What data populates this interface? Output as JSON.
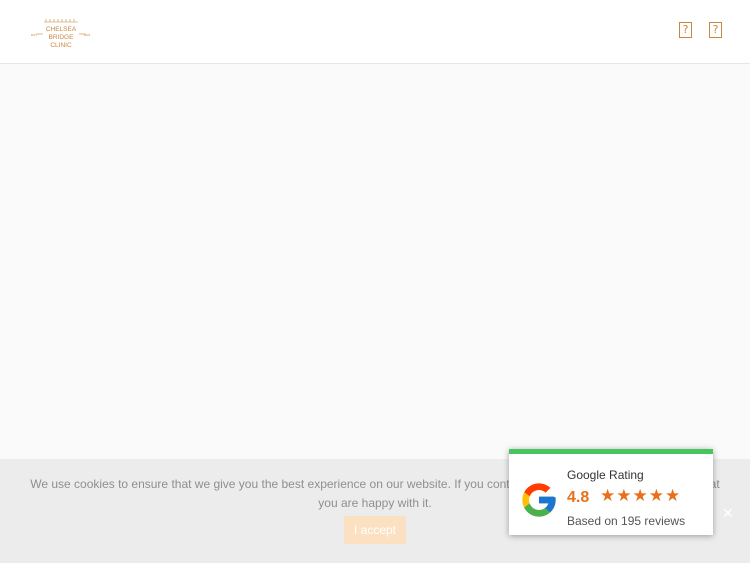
{
  "header": {
    "logo": {
      "lines": [
        "CHELSEA",
        "BRIDGE",
        "CLINIC"
      ],
      "left_mark": "EST",
      "right_mark": "2024"
    },
    "icon_1": "?",
    "icon_2": "?"
  },
  "cookie_banner": {
    "text": "We use cookies to ensure that we give you the best experience on our website. If you continue to use this site we will assume that you are happy with it.",
    "accept_label": "I accept",
    "close_label": "✕"
  },
  "rating_badge": {
    "title": "Google Rating",
    "score": "4.8",
    "stars": 5,
    "reviews_text": "Based on 195 reviews",
    "colors": {
      "accent_bar": "#48c55c",
      "star": "#e7711b"
    }
  },
  "colors": {
    "brand": "#c9863f"
  }
}
